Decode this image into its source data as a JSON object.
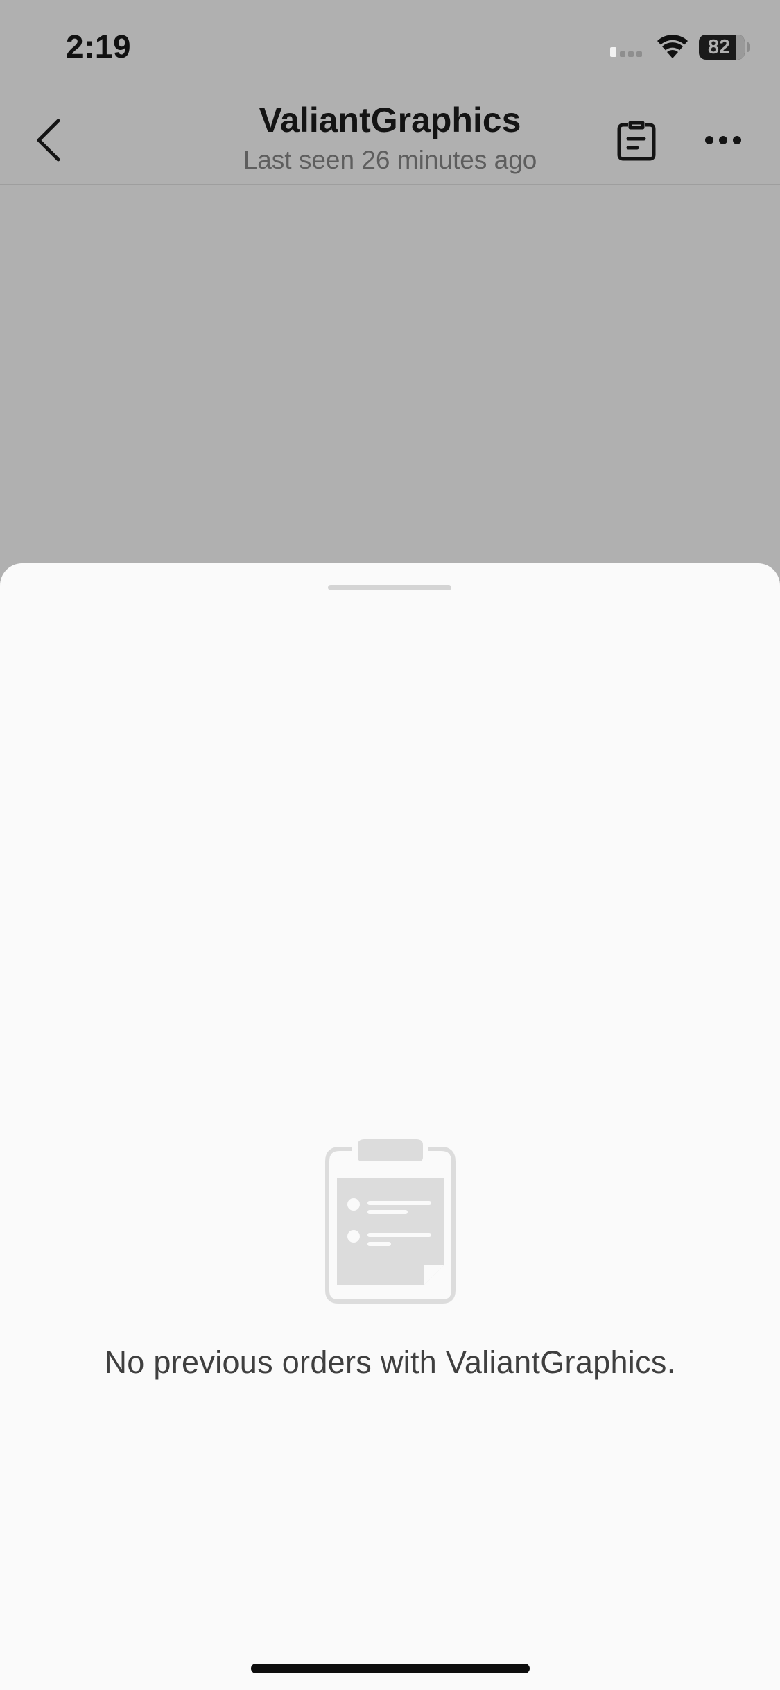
{
  "status_bar": {
    "time": "2:19",
    "battery_percent": "82",
    "battery_level": 0.82
  },
  "header": {
    "title": "ValiantGraphics",
    "subtitle": "Last seen 26 minutes ago"
  },
  "sheet": {
    "empty_message": "No previous orders with ValiantGraphics."
  },
  "colors": {
    "backdrop": "#b0b0b0",
    "sheet_background": "#fafafa",
    "empty_icon": "#dcdcdc"
  },
  "icons": {
    "back": "chevron-left-icon",
    "orders": "clipboard-icon",
    "more": "ellipsis-icon",
    "empty_state": "clipboard-icon"
  }
}
